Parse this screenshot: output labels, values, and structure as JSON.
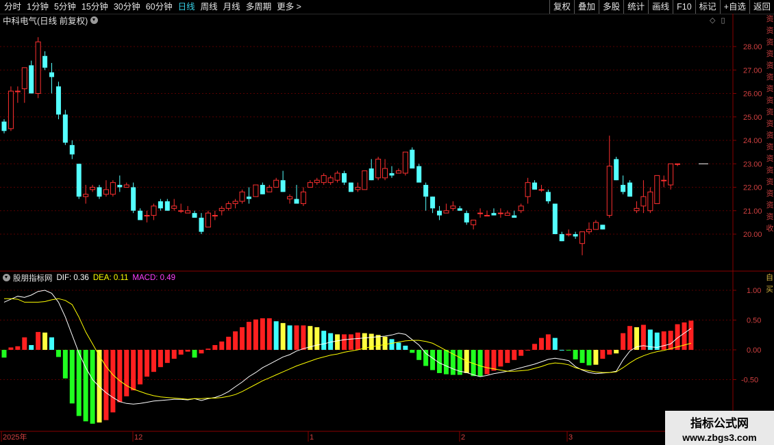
{
  "colors": {
    "up": "#ff3030",
    "down": "#54ffff",
    "grid": "#5a0000",
    "dif": "#ffffff",
    "dea": "#ffff00",
    "macd_label": "#ff40ff"
  },
  "tabs": [
    {
      "label": "分时"
    },
    {
      "label": "1分钟"
    },
    {
      "label": "5分钟"
    },
    {
      "label": "15分钟"
    },
    {
      "label": "30分钟"
    },
    {
      "label": "60分钟"
    },
    {
      "label": "日线",
      "active": true
    },
    {
      "label": "周线"
    },
    {
      "label": "月线"
    },
    {
      "label": "多周期"
    },
    {
      "label": "更多 >"
    }
  ],
  "toolbar": [
    "复权",
    "叠加",
    "多股",
    "统计",
    "画线",
    "F10",
    "标记",
    "+自选",
    "返回"
  ],
  "stock_title": "中科电气(日线 前复权)",
  "indicator": {
    "name": "股朋指标网",
    "dif": "DIF: 0.36",
    "dea": "DEA: 0.11",
    "macd": "MACD: 0.49"
  },
  "right_strip": {
    "top": [
      "资",
      "资",
      "资",
      "资",
      "资",
      "资",
      "资",
      "资",
      "资",
      "资",
      "资",
      "资",
      "资",
      "资",
      "资",
      "资",
      "资",
      "资",
      "收"
    ],
    "bottom": [
      "自",
      "买"
    ]
  },
  "watermark": {
    "line1": "指标公式网",
    "line2": "www.zbgs3.com"
  },
  "chart_data": [
    {
      "type": "candlestick",
      "price_axis": {
        "ylim": [
          19.0,
          28.8
        ],
        "ticks": [
          "28.00",
          "27.00",
          "26.00",
          "25.00",
          "24.00",
          "23.00",
          "22.00",
          "21.00",
          "20.00"
        ]
      },
      "x_labels": [
        "2025年",
        "12",
        "1",
        "2",
        "3"
      ],
      "ohlc": [
        [
          24.8,
          24.9,
          24.3,
          24.4
        ],
        [
          24.5,
          26.3,
          24.4,
          26.1
        ],
        [
          26.1,
          26.3,
          25.6,
          26.1
        ],
        [
          26.2,
          27.1,
          25.6,
          27.1
        ],
        [
          27.2,
          27.4,
          26.3,
          26.0
        ],
        [
          26.0,
          28.4,
          25.8,
          28.2
        ],
        [
          27.6,
          27.8,
          27.0,
          27.1
        ],
        [
          26.9,
          27.3,
          26.0,
          26.7
        ],
        [
          26.3,
          26.5,
          24.9,
          25.1
        ],
        [
          25.1,
          25.3,
          23.8,
          23.9
        ],
        [
          23.8,
          24.0,
          23.2,
          23.4
        ],
        [
          23.0,
          23.0,
          21.5,
          21.6
        ],
        [
          21.6,
          22.1,
          21.3,
          21.7
        ],
        [
          21.9,
          22.1,
          21.8,
          22.0
        ],
        [
          22.0,
          22.1,
          21.5,
          21.6
        ],
        [
          21.7,
          22.3,
          21.6,
          21.9
        ],
        [
          21.7,
          22.3,
          21.6,
          22.2
        ],
        [
          22.1,
          22.5,
          21.8,
          22.0
        ],
        [
          22.0,
          22.2,
          22.0,
          22.1
        ],
        [
          22.0,
          22.2,
          20.9,
          21.0
        ],
        [
          21.0,
          21.1,
          20.6,
          20.6
        ],
        [
          20.8,
          21.0,
          20.5,
          20.8
        ],
        [
          20.8,
          21.3,
          20.6,
          21.2
        ],
        [
          21.4,
          21.5,
          21.0,
          21.1
        ],
        [
          21.4,
          21.5,
          21.0,
          21.0
        ],
        [
          21.1,
          21.5,
          21.0,
          21.2
        ],
        [
          21.0,
          21.3,
          20.9,
          21.0
        ],
        [
          20.9,
          21.2,
          20.9,
          21.0
        ],
        [
          20.9,
          21.0,
          20.7,
          20.7
        ],
        [
          20.7,
          20.9,
          20.0,
          20.1
        ],
        [
          20.3,
          21.0,
          20.3,
          20.9
        ],
        [
          20.8,
          21.0,
          20.6,
          20.8
        ],
        [
          21.0,
          21.2,
          20.8,
          21.1
        ],
        [
          21.1,
          21.4,
          21.0,
          21.3
        ],
        [
          21.3,
          21.5,
          21.1,
          21.4
        ],
        [
          21.4,
          21.9,
          21.3,
          21.8
        ],
        [
          21.6,
          22.0,
          21.3,
          21.5
        ],
        [
          21.6,
          22.1,
          21.6,
          22.1
        ],
        [
          22.1,
          22.2,
          21.7,
          21.7
        ],
        [
          21.8,
          22.1,
          21.8,
          22.0
        ],
        [
          22.0,
          22.4,
          22.0,
          22.3
        ],
        [
          22.3,
          22.7,
          21.8,
          21.8
        ],
        [
          21.5,
          21.7,
          21.3,
          21.6
        ],
        [
          21.5,
          22.1,
          21.4,
          21.3
        ],
        [
          21.3,
          22.0,
          21.2,
          21.8
        ],
        [
          22.0,
          22.3,
          22.0,
          22.2
        ],
        [
          22.2,
          22.4,
          22.1,
          22.3
        ],
        [
          22.2,
          22.6,
          22.1,
          22.5
        ],
        [
          22.2,
          22.5,
          22.1,
          22.4
        ],
        [
          22.3,
          22.7,
          22.2,
          22.6
        ],
        [
          22.6,
          22.7,
          22.1,
          22.2
        ],
        [
          22.2,
          22.2,
          21.9,
          21.8
        ],
        [
          21.9,
          22.2,
          21.8,
          22.0
        ],
        [
          21.9,
          22.7,
          21.9,
          22.7
        ],
        [
          22.8,
          23.2,
          22.3,
          22.3
        ],
        [
          22.4,
          23.3,
          22.3,
          23.2
        ],
        [
          22.4,
          23.2,
          22.3,
          22.8
        ],
        [
          22.6,
          22.9,
          22.4,
          22.5
        ],
        [
          22.6,
          22.8,
          22.6,
          22.7
        ],
        [
          22.6,
          23.5,
          22.5,
          23.5
        ],
        [
          23.6,
          23.7,
          22.9,
          22.8
        ],
        [
          22.9,
          23.0,
          22.3,
          22.2
        ],
        [
          22.1,
          22.2,
          21.0,
          21.6
        ],
        [
          21.6,
          21.6,
          20.9,
          21.1
        ],
        [
          21.0,
          21.2,
          20.6,
          20.8
        ],
        [
          20.9,
          21.3,
          20.9,
          21.0
        ],
        [
          21.1,
          21.4,
          21.0,
          21.2
        ],
        [
          21.1,
          21.2,
          21.0,
          21.0
        ],
        [
          20.9,
          21.0,
          20.4,
          20.5
        ],
        [
          20.4,
          20.5,
          20.2,
          20.6
        ],
        [
          20.9,
          21.1,
          20.7,
          20.9
        ],
        [
          20.8,
          21.0,
          20.8,
          20.8
        ],
        [
          20.9,
          21.1,
          20.8,
          20.8
        ],
        [
          20.9,
          21.1,
          20.7,
          20.9
        ],
        [
          20.8,
          21.0,
          20.8,
          20.9
        ],
        [
          20.8,
          21.0,
          20.7,
          20.7
        ],
        [
          21.0,
          21.3,
          20.9,
          21.2
        ],
        [
          21.6,
          22.4,
          21.3,
          22.2
        ],
        [
          22.2,
          22.3,
          21.9,
          21.9
        ],
        [
          21.9,
          22.1,
          21.8,
          21.9
        ],
        [
          21.8,
          21.9,
          21.3,
          21.4
        ],
        [
          21.3,
          21.3,
          20.0,
          20.0
        ],
        [
          20.0,
          20.1,
          19.7,
          19.7
        ],
        [
          20.0,
          20.2,
          19.9,
          20.0
        ],
        [
          20.0,
          20.1,
          19.8,
          19.9
        ],
        [
          19.6,
          20.1,
          19.1,
          20.1
        ],
        [
          20.1,
          20.5,
          20.0,
          20.2
        ],
        [
          20.2,
          20.6,
          20.2,
          20.5
        ],
        [
          20.4,
          20.4,
          20.2,
          20.2
        ],
        [
          20.8,
          24.2,
          20.7,
          22.9
        ],
        [
          23.2,
          23.3,
          22.3,
          22.3
        ],
        [
          22.1,
          22.5,
          21.7,
          21.8
        ],
        [
          22.2,
          22.3,
          21.6,
          21.6
        ],
        [
          21.0,
          21.4,
          20.9,
          21.1
        ],
        [
          21.2,
          22.3,
          20.9,
          21.6
        ],
        [
          21.0,
          22.0,
          20.9,
          21.8
        ],
        [
          21.3,
          22.2,
          21.3,
          22.5
        ],
        [
          22.3,
          22.5,
          22.0,
          22.3
        ],
        [
          22.1,
          23.0,
          21.9,
          23.0
        ],
        [
          23.0,
          23.0,
          22.9,
          23.0
        ]
      ]
    },
    {
      "type": "bar",
      "name": "MACD",
      "ylim": [
        -1.35,
        1.25
      ],
      "ticks": [
        "1.00",
        "0.50",
        "0.00",
        "-0.50"
      ],
      "series": [
        {
          "name": "MACD",
          "values": [
            -0.13,
            0.04,
            0.06,
            0.21,
            0.08,
            0.3,
            0.29,
            0.21,
            -0.12,
            -0.48,
            -0.9,
            -1.11,
            -1.2,
            -1.24,
            -1.22,
            -1.18,
            -1.05,
            -0.88,
            -0.78,
            -0.68,
            -0.58,
            -0.45,
            -0.37,
            -0.29,
            -0.22,
            -0.15,
            -0.08,
            -0.03,
            -0.13,
            -0.06,
            0.02,
            0.08,
            0.14,
            0.22,
            0.31,
            0.38,
            0.47,
            0.51,
            0.53,
            0.53,
            0.48,
            0.45,
            0.41,
            0.41,
            0.41,
            0.4,
            0.38,
            0.32,
            0.28,
            0.26,
            0.26,
            0.26,
            0.29,
            0.28,
            0.27,
            0.25,
            0.22,
            0.18,
            0.12,
            0.07,
            -0.05,
            -0.17,
            -0.27,
            -0.34,
            -0.39,
            -0.41,
            -0.42,
            -0.42,
            -0.39,
            -0.44,
            -0.45,
            -0.41,
            -0.35,
            -0.28,
            -0.22,
            -0.17,
            -0.1,
            -0.01,
            0.1,
            0.2,
            0.26,
            0.2,
            0.0,
            -0.01,
            -0.16,
            -0.22,
            -0.26,
            -0.25,
            -0.15,
            -0.08,
            -0.06,
            0.28,
            0.4,
            0.38,
            0.42,
            0.34,
            0.29,
            0.31,
            0.32,
            0.43,
            0.46,
            0.49
          ]
        },
        {
          "name": "DIF",
          "values": [
            0.8,
            0.85,
            0.9,
            0.88,
            0.92,
            0.98,
            1.0,
            0.95,
            0.8,
            0.55,
            0.25,
            -0.05,
            -0.3,
            -0.5,
            -0.62,
            -0.72,
            -0.8,
            -0.87,
            -0.9,
            -0.91,
            -0.9,
            -0.88,
            -0.86,
            -0.85,
            -0.84,
            -0.83,
            -0.83,
            -0.84,
            -0.82,
            -0.85,
            -0.82,
            -0.8,
            -0.76,
            -0.7,
            -0.62,
            -0.54,
            -0.45,
            -0.38,
            -0.3,
            -0.24,
            -0.18,
            -0.12,
            -0.08,
            -0.02,
            0.02,
            0.05,
            0.08,
            0.1,
            0.13,
            0.15,
            0.17,
            0.18,
            0.19,
            0.2,
            0.21,
            0.22,
            0.23,
            0.25,
            0.28,
            0.26,
            0.17,
            0.08,
            -0.06,
            -0.14,
            -0.22,
            -0.27,
            -0.32,
            -0.36,
            -0.38,
            -0.42,
            -0.45,
            -0.43,
            -0.4,
            -0.38,
            -0.36,
            -0.33,
            -0.3,
            -0.27,
            -0.24,
            -0.2,
            -0.16,
            -0.14,
            -0.16,
            -0.18,
            -0.28,
            -0.34,
            -0.38,
            -0.4,
            -0.39,
            -0.38,
            -0.36,
            -0.17,
            -0.02,
            0.05,
            0.07,
            0.05,
            0.04,
            0.07,
            0.1,
            0.2,
            0.28,
            0.36
          ]
        },
        {
          "name": "DEA",
          "values": [
            0.86,
            0.86,
            0.85,
            0.8,
            0.8,
            0.8,
            0.81,
            0.84,
            0.86,
            0.83,
            0.76,
            0.55,
            0.3,
            0.1,
            -0.1,
            -0.28,
            -0.42,
            -0.52,
            -0.6,
            -0.66,
            -0.7,
            -0.74,
            -0.77,
            -0.79,
            -0.8,
            -0.81,
            -0.82,
            -0.83,
            -0.82,
            -0.82,
            -0.81,
            -0.81,
            -0.8,
            -0.78,
            -0.75,
            -0.7,
            -0.64,
            -0.58,
            -0.52,
            -0.47,
            -0.42,
            -0.37,
            -0.32,
            -0.27,
            -0.23,
            -0.19,
            -0.15,
            -0.12,
            -0.09,
            -0.07,
            -0.04,
            -0.02,
            0.0,
            0.03,
            0.05,
            0.07,
            0.09,
            0.11,
            0.13,
            0.15,
            0.16,
            0.16,
            0.14,
            0.11,
            0.05,
            -0.01,
            -0.07,
            -0.13,
            -0.19,
            -0.23,
            -0.27,
            -0.3,
            -0.32,
            -0.34,
            -0.36,
            -0.36,
            -0.35,
            -0.34,
            -0.31,
            -0.28,
            -0.24,
            -0.22,
            -0.23,
            -0.25,
            -0.3,
            -0.33,
            -0.35,
            -0.37,
            -0.38,
            -0.38,
            -0.37,
            -0.3,
            -0.22,
            -0.15,
            -0.1,
            -0.06,
            -0.03,
            -0.01,
            0.02,
            0.05,
            0.08,
            0.11
          ]
        }
      ]
    }
  ]
}
